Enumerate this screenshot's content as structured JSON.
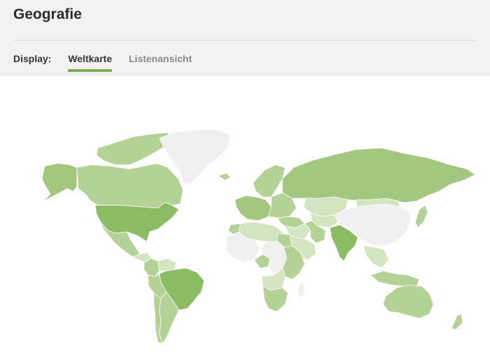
{
  "page": {
    "title": "Geografie"
  },
  "display": {
    "label": "Display:",
    "tabs": [
      {
        "label": "Weltkarte",
        "active": true
      },
      {
        "label": "Listenansicht",
        "active": false
      }
    ]
  },
  "map": {
    "type": "choropleth world map",
    "colors": {
      "none": "#f0f0f0",
      "low": "#d3e4c1",
      "mid": "#b5d296",
      "high": "#a3c77e",
      "max": "#8bbb62",
      "accent": "#7fad55"
    },
    "regions": [
      {
        "name": "Alaska",
        "level": "high"
      },
      {
        "name": "Canada",
        "level": "mid"
      },
      {
        "name": "Canadian Arctic Islands",
        "level": "mid"
      },
      {
        "name": "Greenland",
        "level": "none"
      },
      {
        "name": "United States",
        "level": "max"
      },
      {
        "name": "Mexico",
        "level": "mid"
      },
      {
        "name": "Central America",
        "level": "low"
      },
      {
        "name": "Colombia",
        "level": "mid"
      },
      {
        "name": "Venezuela",
        "level": "low"
      },
      {
        "name": "Brazil",
        "level": "max"
      },
      {
        "name": "Peru",
        "level": "mid"
      },
      {
        "name": "Argentina",
        "level": "mid"
      },
      {
        "name": "Chile",
        "level": "mid"
      },
      {
        "name": "Iceland",
        "level": "mid"
      },
      {
        "name": "Scandinavia",
        "level": "mid"
      },
      {
        "name": "Western Europe",
        "level": "high"
      },
      {
        "name": "Eastern Europe",
        "level": "mid"
      },
      {
        "name": "Russia",
        "level": "high"
      },
      {
        "name": "Kazakhstan",
        "level": "low"
      },
      {
        "name": "Central Asia",
        "level": "low"
      },
      {
        "name": "Turkey",
        "level": "mid"
      },
      {
        "name": "Middle East",
        "level": "low"
      },
      {
        "name": "Saudi Arabia",
        "level": "low"
      },
      {
        "name": "Iran",
        "level": "mid"
      },
      {
        "name": "India",
        "level": "max"
      },
      {
        "name": "China",
        "level": "none"
      },
      {
        "name": "Mongolia",
        "level": "low"
      },
      {
        "name": "Japan",
        "level": "mid"
      },
      {
        "name": "Southeast Asia",
        "level": "low"
      },
      {
        "name": "Indonesia",
        "level": "mid"
      },
      {
        "name": "Australia",
        "level": "mid"
      },
      {
        "name": "New Zealand",
        "level": "mid"
      },
      {
        "name": "North Africa",
        "level": "low"
      },
      {
        "name": "Morocco",
        "level": "mid"
      },
      {
        "name": "Egypt",
        "level": "mid"
      },
      {
        "name": "West Africa",
        "level": "none"
      },
      {
        "name": "Nigeria",
        "level": "mid"
      },
      {
        "name": "Central Africa",
        "level": "none"
      },
      {
        "name": "East Africa",
        "level": "mid"
      },
      {
        "name": "Angola",
        "level": "low"
      },
      {
        "name": "Southern Africa",
        "level": "mid"
      },
      {
        "name": "Madagascar",
        "level": "none"
      }
    ]
  }
}
